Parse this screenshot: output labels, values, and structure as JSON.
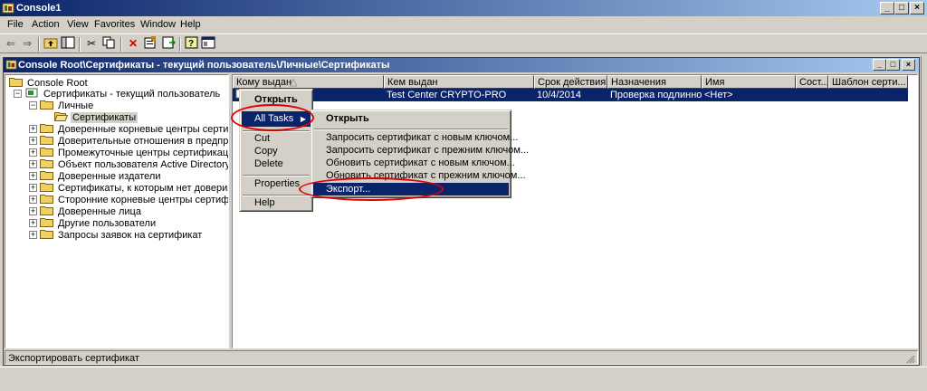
{
  "app": {
    "title": "Console1"
  },
  "menubar": [
    "File",
    "Action",
    "View",
    "Favorites",
    "Window",
    "Help"
  ],
  "inner_window": {
    "title": "Console Root\\Сертификаты - текущий пользователь\\Личные\\Сертификаты"
  },
  "tree": {
    "root": "Console Root",
    "store": "Сертификаты - текущий пользователь",
    "personal": "Личные",
    "certificates": "Сертификаты",
    "items": [
      "Доверенные корневые центры сертификации",
      "Доверительные отношения в предприятии",
      "Промежуточные центры сертификации",
      "Объект пользователя Active Directory",
      "Доверенные издатели",
      "Сертификаты, к которым нет доверия",
      "Сторонние корневые центры сертификации",
      "Доверенные лица",
      "Другие пользователи",
      "Запросы заявок на сертификат"
    ]
  },
  "list": {
    "columns": [
      "Кому выдан",
      "Кем выдан",
      "Срок действия",
      "Назначения",
      "Имя",
      "Сост...",
      "Шаблон серти..."
    ],
    "row": {
      "issued_by": "Test Center CRYPTO-PRO",
      "expires": "10/4/2014",
      "purposes": "Проверка подлинно...",
      "name": "<Нет>"
    }
  },
  "context_menu": {
    "open": "Открыть",
    "all_tasks": "All Tasks",
    "cut": "Cut",
    "copy": "Copy",
    "delete": "Delete",
    "properties": "Properties",
    "help": "Help"
  },
  "submenu": {
    "open": "Открыть",
    "items": [
      "Запросить сертификат с новым ключом...",
      "Запросить сертификат с прежним ключом...",
      "Обновить сертификат с новым ключом...",
      "Обновить сертификат с прежним ключом...",
      "Экспорт..."
    ]
  },
  "status": "Экспортировать сертификат",
  "colors": {
    "titlebar": "#0a246a",
    "highlight": "#0a246a",
    "annotation": "#e00000",
    "chrome": "#d4d0c8"
  }
}
